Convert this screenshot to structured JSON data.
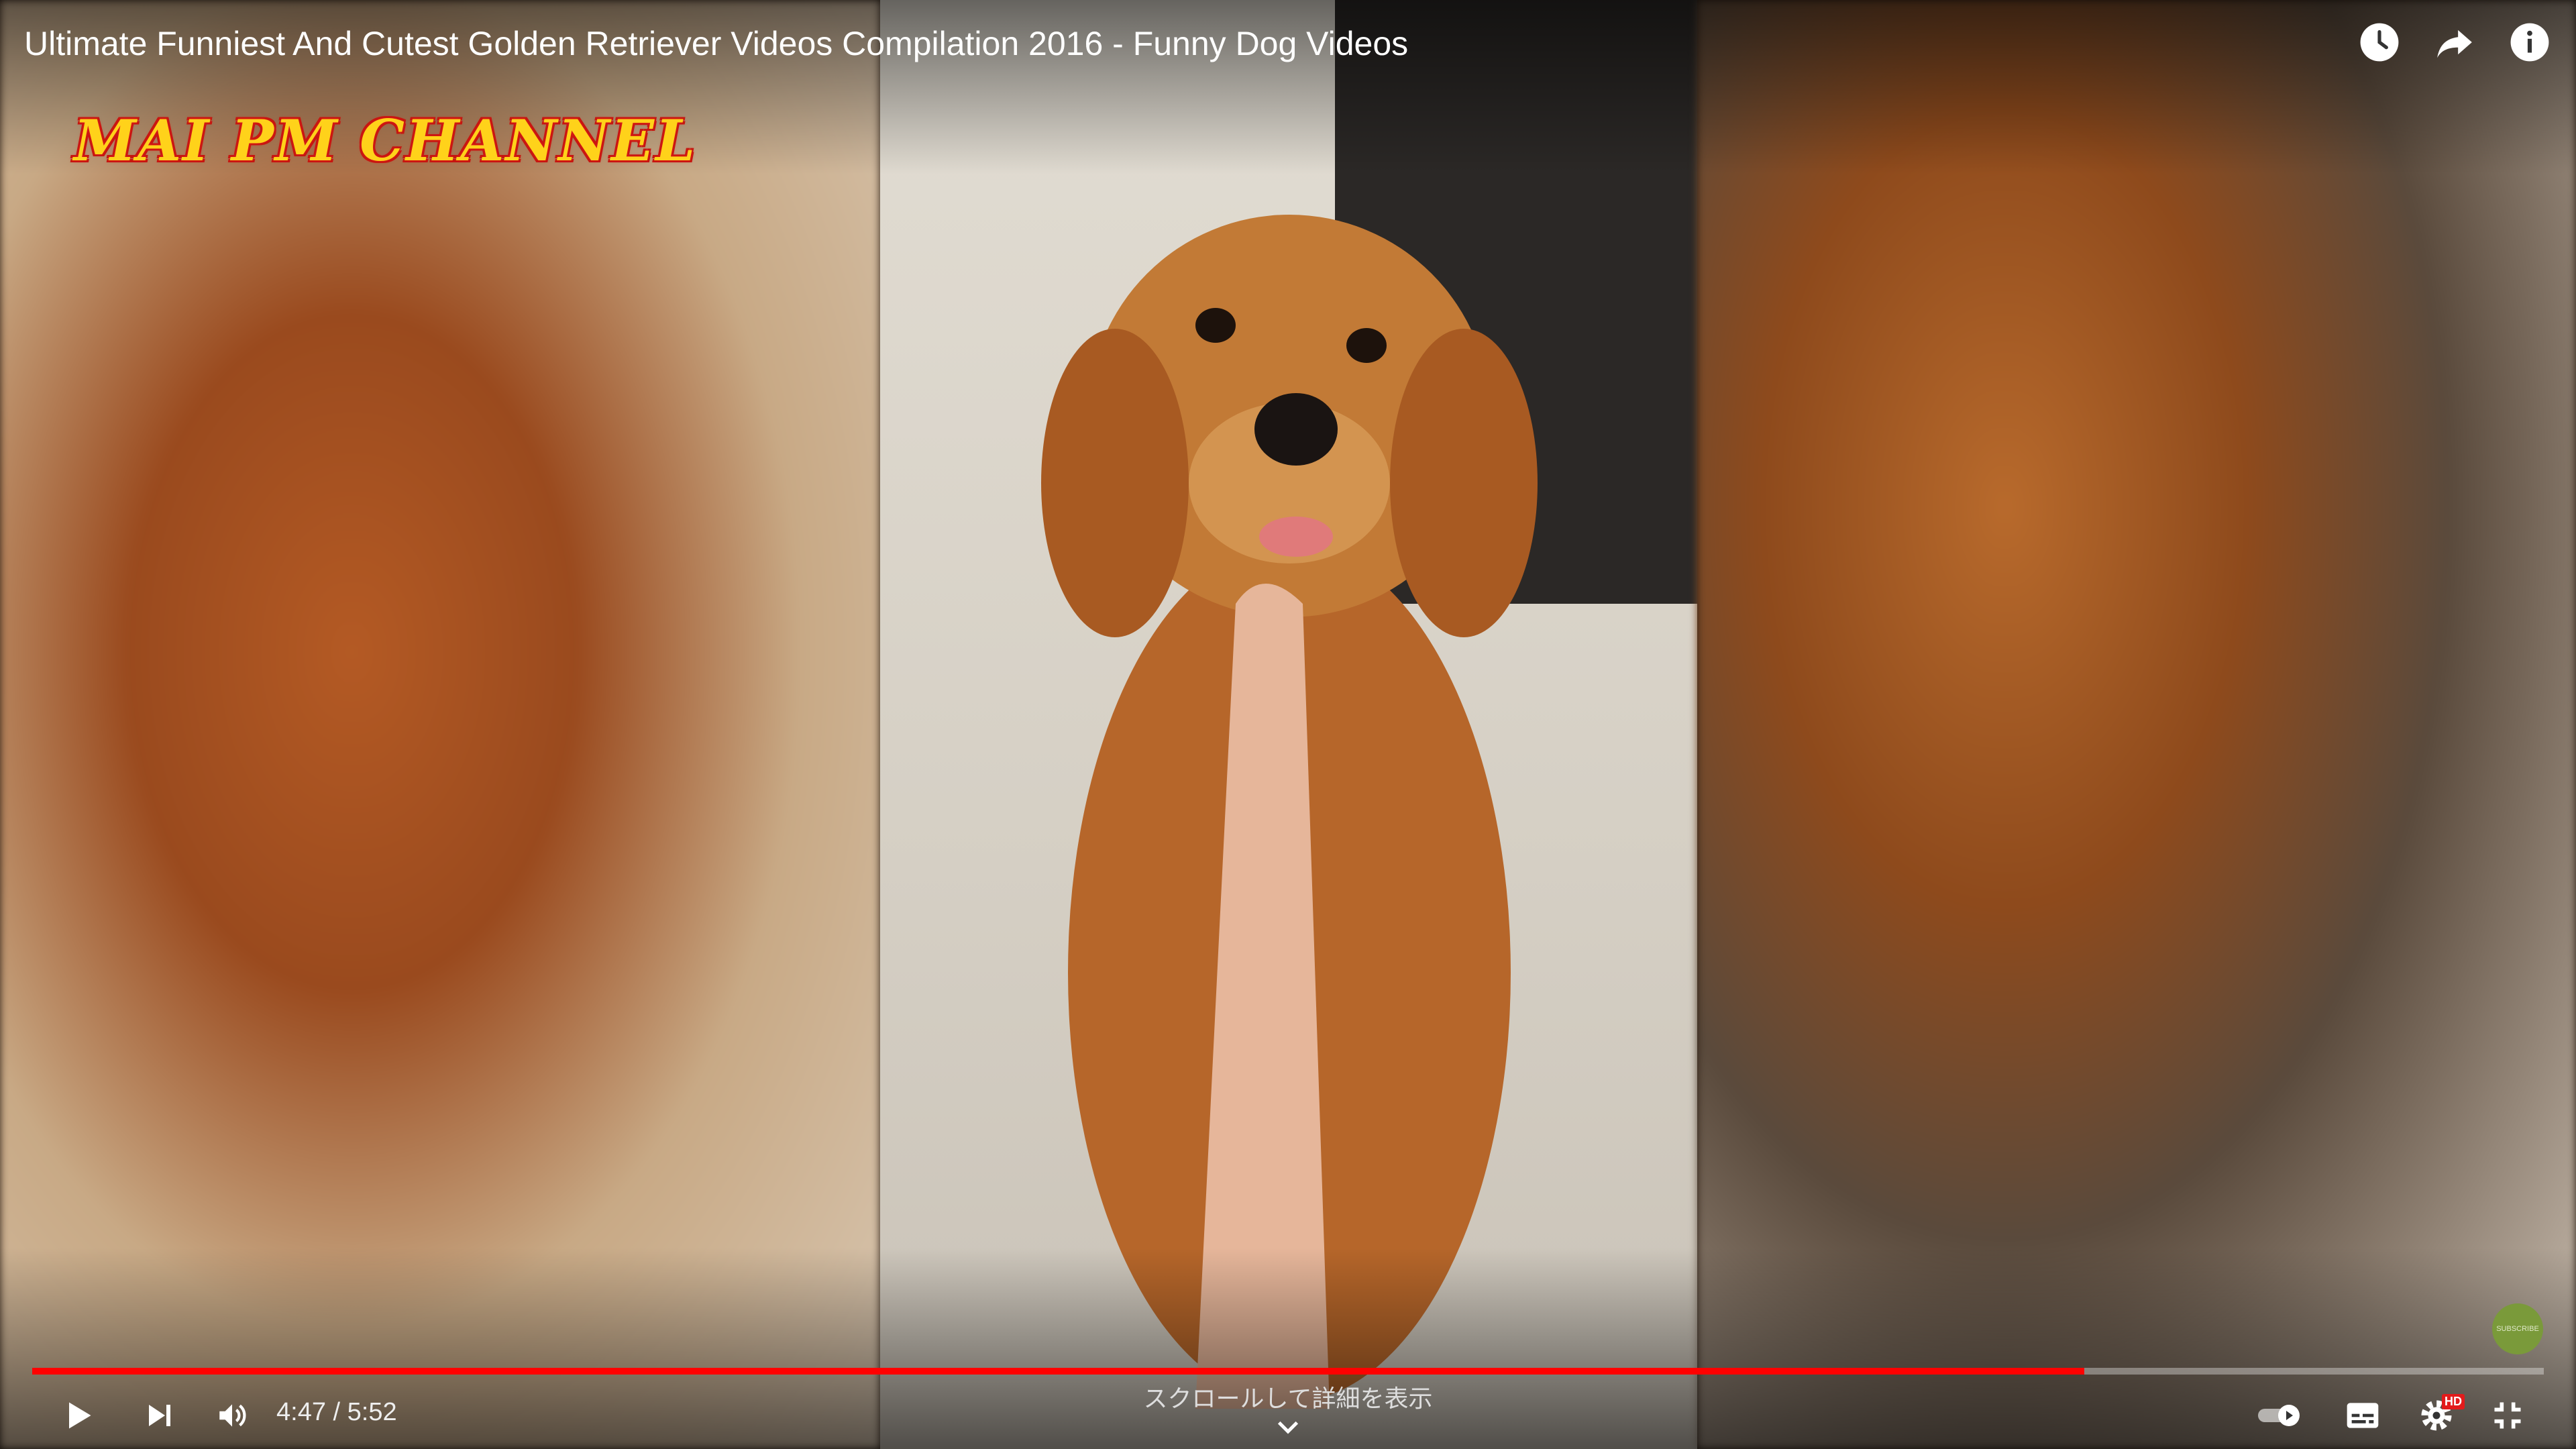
{
  "video": {
    "title": "Ultimate Funniest And Cutest Golden Retriever Videos Compilation 2016 - Funny Dog Videos",
    "watermark": "MAI PM CHANNEL",
    "subscribe_badge": "SUBSCRIBE"
  },
  "top_icons": [
    "watch-later-icon",
    "share-icon",
    "info-icon"
  ],
  "player": {
    "current_time": "4:47",
    "duration": "5:52",
    "time_display": "4:47 / 5:52",
    "progress_played_fraction": 0.817,
    "progress_loaded_fraction": 0.817,
    "scroll_hint": "スクロールして詳細を表示",
    "settings_badge": "HD"
  },
  "controls": {
    "left": [
      "play-icon",
      "next-icon",
      "volume-icon"
    ],
    "right": [
      "autoplay-toggle-icon",
      "subtitles-icon",
      "settings-icon",
      "exit-fullscreen-icon"
    ]
  },
  "colors": {
    "progress": "#ff0000",
    "badge": "#e21b1b",
    "watermark": "#ffd21a"
  }
}
